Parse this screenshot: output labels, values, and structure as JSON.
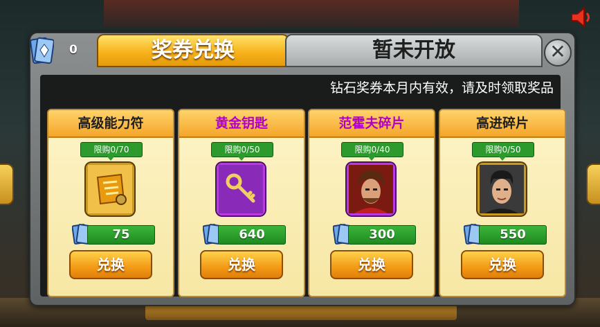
{
  "header": {
    "ticket_count": "0",
    "tabs": [
      {
        "label": "奖券兑换",
        "active": true
      },
      {
        "label": "暂未开放",
        "active": false
      }
    ],
    "close_symbol": "✕"
  },
  "notice": "钻石奖券本月内有效，请及时领取奖品",
  "items": [
    {
      "title": "高级能力符",
      "title_color": "#1e1e1e",
      "limit": "限购0/70",
      "price": "75",
      "button": "兑换",
      "frame_color": "#e0a020",
      "icon": "talisman-icon"
    },
    {
      "title": "黄金钥匙",
      "title_color": "#b000c8",
      "limit": "限购0/50",
      "price": "640",
      "button": "兑换",
      "frame_color": "#a020c8",
      "icon": "golden-key-icon"
    },
    {
      "title": "范霍夫碎片",
      "title_color": "#b000c8",
      "limit": "限购0/40",
      "price": "300",
      "button": "兑换",
      "frame_color": "#a020c8",
      "icon": "player-portrait-icon"
    },
    {
      "title": "高进碎片",
      "title_color": "#1e1e1e",
      "limit": "限购0/50",
      "price": "550",
      "button": "兑换",
      "frame_color": "#e0a020",
      "icon": "player-portrait-icon"
    }
  ],
  "colors": {
    "tab_active": "#f7b31c",
    "price_green": "#2c9a2c",
    "button_orange": "#f39a16"
  }
}
